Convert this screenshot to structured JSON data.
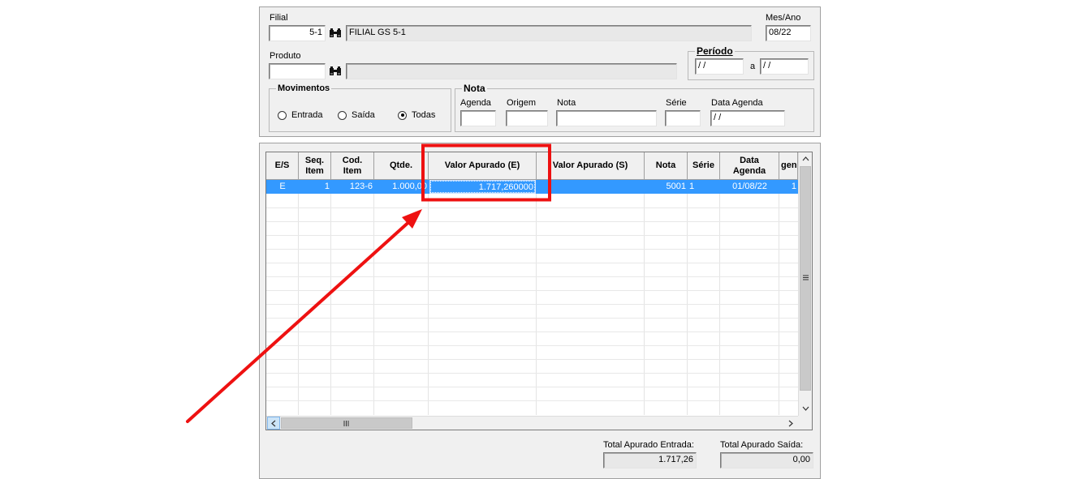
{
  "filter": {
    "filial_label": "Filial",
    "filial_code": "5-1",
    "filial_name": "FILIAL GS 5-1",
    "mes_ano_label": "Mes/Ano",
    "mes_ano_value": "08/22",
    "produto_label": "Produto",
    "produto_code": "",
    "produto_name": "",
    "periodo_title": "Período",
    "periodo_from": " / /",
    "periodo_sep": "a",
    "periodo_to": " / /"
  },
  "movimentos": {
    "title": "Movimentos",
    "options": [
      "Entrada",
      "Saída",
      "Todas"
    ],
    "selected": "Todas"
  },
  "nota": {
    "title": "Nota",
    "agenda_label": "Agenda",
    "origem_label": "Origem",
    "nota_label": "Nota",
    "serie_label": "Série",
    "data_agenda_label": "Data Agenda",
    "agenda_value": "",
    "origem_value": "",
    "nota_value": "",
    "serie_value": "",
    "data_agenda_value": " / /"
  },
  "grid": {
    "columns": [
      "E/S",
      "Seq. Item",
      "Cod. Item",
      "Qtde.",
      "Valor Apurado (E)",
      "Valor Apurado (S)",
      "Nota",
      "Série",
      "Data Agenda",
      "gen"
    ],
    "rows": [
      [
        "E",
        "1",
        "123-6",
        "1.000,00",
        "1.717,260000",
        "",
        "5001",
        "1",
        "01/08/22",
        "1"
      ]
    ],
    "selected_row": 0,
    "highlight_color": "#3399ff"
  },
  "totals": {
    "entrada_label": "Total Apurado Entrada:",
    "entrada_value": "1.717,26",
    "saida_label": "Total Apurado Saída:",
    "saida_value": "0,00"
  },
  "annotation": {
    "box_color": "#ee1111",
    "arrow_color": "#ee1111"
  }
}
